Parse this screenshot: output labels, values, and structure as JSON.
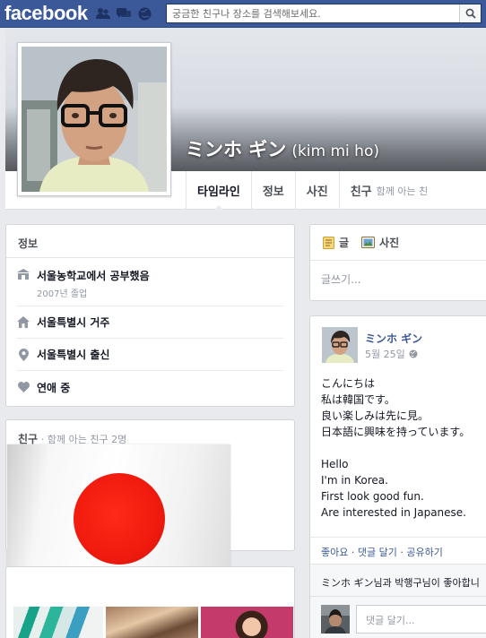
{
  "topbar": {
    "logo": "facebook",
    "search_placeholder": "궁금한 친구나 장소를 검색해보세요.",
    "colors": {
      "bar": "#3b5998",
      "link": "#3b5998"
    },
    "jewels": [
      "friend-requests-icon",
      "messages-icon",
      "notifications-globe-icon"
    ]
  },
  "profile": {
    "name": "ミンホ ギン",
    "alternate_name": "(kim mi ho)"
  },
  "tabs": [
    {
      "label": "타임라인"
    },
    {
      "label": "정보"
    },
    {
      "label": "사진"
    },
    {
      "label": "친구",
      "sub": "함께 아는 친"
    }
  ],
  "info": {
    "heading": "정보",
    "items": [
      {
        "icon": "school-icon",
        "text": "서울농학교에서 공부했음",
        "sub": "2007년 졸업"
      },
      {
        "icon": "home-icon",
        "text": "서울특별시 거주"
      },
      {
        "icon": "location-pin-icon",
        "text": "서울특별시 출신"
      },
      {
        "icon": "heart-icon",
        "text": "연애 중"
      }
    ]
  },
  "friends": {
    "heading": "친구",
    "sub": "· 함께 아는 친구 2명"
  },
  "composer": {
    "tabs": [
      {
        "icon": "status-icon",
        "label": "글"
      },
      {
        "icon": "photo-icon",
        "label": "사진"
      }
    ],
    "placeholder": "글쓰기..."
  },
  "post": {
    "author": "ミンホ ギン",
    "time": "5월 25일",
    "privacy_icon": "public-globe-icon",
    "lines_ja": [
      "こんにちは",
      "私は韓国です。",
      "良い楽しみは先に見。",
      "日本語に興味を持っています。"
    ],
    "lines_en": [
      "Hello",
      "I'm in Korea.",
      "First look good fun.",
      "Are interested in Japanese."
    ],
    "actions": {
      "like": "좋아요",
      "sep": " · ",
      "comment": "댓글 달기",
      "share": "공유하기"
    },
    "likes_text": "ミンホ ギン님과 박행구님이 좋아합니",
    "comment_placeholder": "댓글 달기..."
  }
}
